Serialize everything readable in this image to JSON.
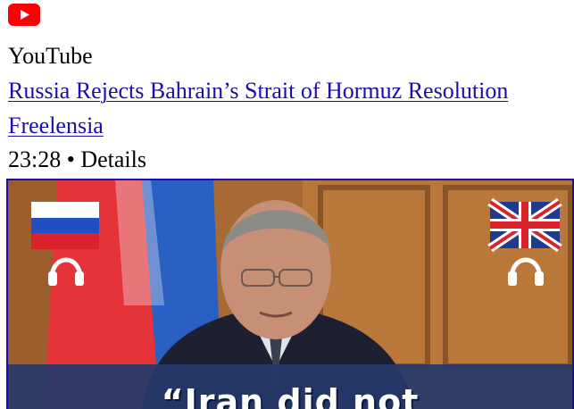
{
  "source": {
    "name": "YouTube",
    "icon": "youtube-play-icon",
    "icon_color": "#ff0000"
  },
  "video": {
    "title": "Russia Rejects Bahrain’s Strait of Hormuz Resolution",
    "channel": "Freelensia",
    "duration": "23:28",
    "separator": "•",
    "details_label": "Details"
  },
  "thumbnail": {
    "caption": "“Iran did not",
    "left_flag": "russia-flag-icon",
    "right_flag": "uk-flag-icon",
    "audio_icon": "headphones-icon"
  },
  "colors": {
    "link": "#1a0dab",
    "caption_band": "#24386a"
  }
}
